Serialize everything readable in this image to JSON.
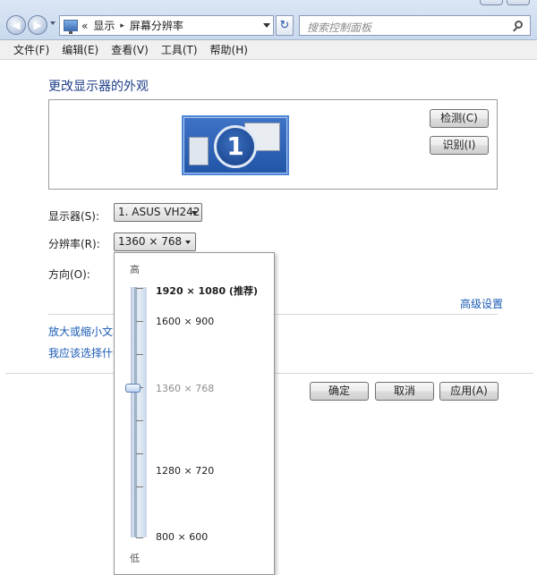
{
  "address": {
    "breadcrumb_prefix": "«",
    "crumb_1": "显示",
    "separator": "▸",
    "crumb_2": "屏幕分辨率",
    "refresh_symbol": "↻",
    "search_placeholder": "搜索控制面板"
  },
  "menu": [
    "文件(F)",
    "编辑(E)",
    "查看(V)",
    "工具(T)",
    "帮助(H)"
  ],
  "page": {
    "title": "更改显示器的外观",
    "monitor_number": "1",
    "detect_button": "检测(C)",
    "identify_button": "识别(I)"
  },
  "fields": {
    "display_label": "显示器(S):",
    "display_value": "1. ASUS VH242",
    "resolution_label": "分辨率(R):",
    "resolution_value": "1360 × 768",
    "orientation_label": "方向(O):"
  },
  "links": {
    "advanced": "高级设置",
    "text_size": "放大或缩小文本",
    "which": "我应该选择什么"
  },
  "footer": {
    "ok": "确定",
    "cancel": "取消",
    "apply": "应用(A)"
  },
  "resolution_popup": {
    "high_label": "高",
    "low_label": "低",
    "options": [
      {
        "label": "1920 × 1080 (推荐)",
        "style": "bold"
      },
      {
        "label": "1600 × 900",
        "style": "normal"
      },
      {
        "label": "1360 × 768",
        "style": "current"
      },
      {
        "label": "1280 × 720",
        "style": "normal"
      },
      {
        "label": "800 × 600",
        "style": "normal"
      }
    ]
  },
  "colors": {
    "link": "#1a5bb5",
    "title": "#1e3f8a",
    "monitor_blue": "#2155a8"
  }
}
